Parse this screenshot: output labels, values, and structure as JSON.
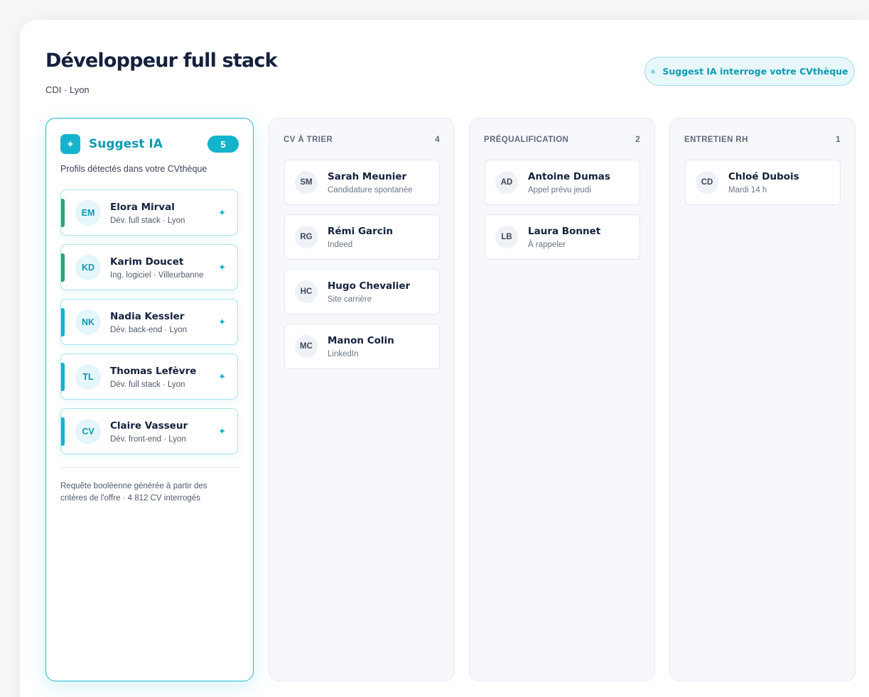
{
  "job": {
    "title": "Développeur full stack",
    "subtitle": "CDI · Lyon"
  },
  "ia_pill": {
    "label": "Suggest IA interroge votre CVthèque"
  },
  "suggest": {
    "title": "Suggest IA",
    "count": "5",
    "subtitle": "Profils détectés dans votre CVthèque",
    "items": [
      {
        "initials": "EM",
        "name": "Elora Mirval",
        "meta": "Dév. full stack · Lyon",
        "accent": "green"
      },
      {
        "initials": "KD",
        "name": "Karim Doucet",
        "meta": "Ing. logiciel · Villeurbanne",
        "accent": "green"
      },
      {
        "initials": "NK",
        "name": "Nadia Kessler",
        "meta": "Dév. back-end · Lyon",
        "accent": "cyan"
      },
      {
        "initials": "TL",
        "name": "Thomas Lefèvre",
        "meta": "Dév. full stack · Lyon",
        "accent": "cyan"
      },
      {
        "initials": "CV",
        "name": "Claire Vasseur",
        "meta": "Dév. front-end · Lyon",
        "accent": "cyan"
      }
    ],
    "footer": "Requête booléenne générée à partir des critères de l'offre · 4 812 CV interrogés"
  },
  "columns": [
    {
      "title": "CV À TRIER",
      "count": "4",
      "cards": [
        {
          "initials": "SM",
          "name": "Sarah Meunier",
          "meta": "Candidature spontanée"
        },
        {
          "initials": "RG",
          "name": "Rémi Garcin",
          "meta": "Indeed"
        },
        {
          "initials": "HC",
          "name": "Hugo Chevalier",
          "meta": "Site carrière"
        },
        {
          "initials": "MC",
          "name": "Manon Colin",
          "meta": "LinkedIn"
        }
      ]
    },
    {
      "title": "PRÉQUALIFICATION",
      "count": "2",
      "cards": [
        {
          "initials": "AD",
          "name": "Antoine Dumas",
          "meta": "Appel prévu jeudi"
        },
        {
          "initials": "LB",
          "name": "Laura Bonnet",
          "meta": "À rappeler"
        }
      ]
    },
    {
      "title": "ENTRETIEN RH",
      "count": "1",
      "cards": [
        {
          "initials": "CD",
          "name": "Chloé Dubois",
          "meta": "Mardi 14 h"
        }
      ]
    }
  ],
  "icons": {
    "sparkle": "sparkle-icon",
    "add": "add-sparkle-icon",
    "status_dot": "status-dot-icon"
  },
  "colors": {
    "accent": "#14b3cc",
    "accent_text": "#0c9bb3",
    "green": "#2ea56f",
    "title": "#14213d"
  }
}
